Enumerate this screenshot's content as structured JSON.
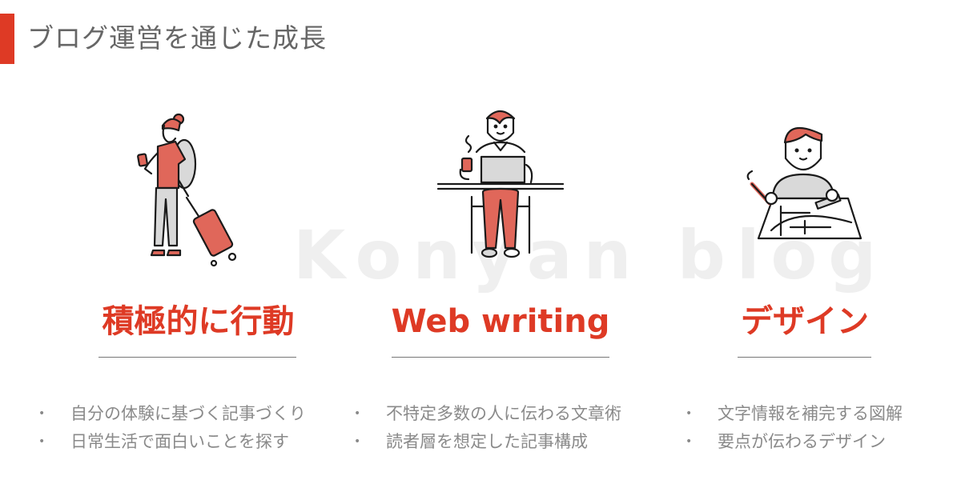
{
  "header": {
    "title": "ブログ運営を通じた成長",
    "accent_color": "#de3a25"
  },
  "watermark": "Konyan blog",
  "columns": [
    {
      "illustration": "traveler-with-suitcase-illustration",
      "title": "積極的に行動",
      "bullets": [
        "自分の体験に基づく記事づくり",
        "日常生活で面白いことを探す"
      ]
    },
    {
      "illustration": "person-writing-on-laptop-illustration",
      "title": "Web writing",
      "bullets": [
        "不特定多数の人に伝わる文章術",
        "読者層を想定した記事構成"
      ]
    },
    {
      "illustration": "person-drawing-design-illustration",
      "title": "デザイン",
      "bullets": [
        "文字情報を補完する図解",
        "要点が伝わるデザイン"
      ]
    }
  ],
  "bullet_glyph": "•",
  "colors": {
    "accent": "#de3a25",
    "illustration_red": "#e0675a",
    "illustration_gray": "#d9d9d9",
    "text_gray": "#8a8a8a"
  }
}
